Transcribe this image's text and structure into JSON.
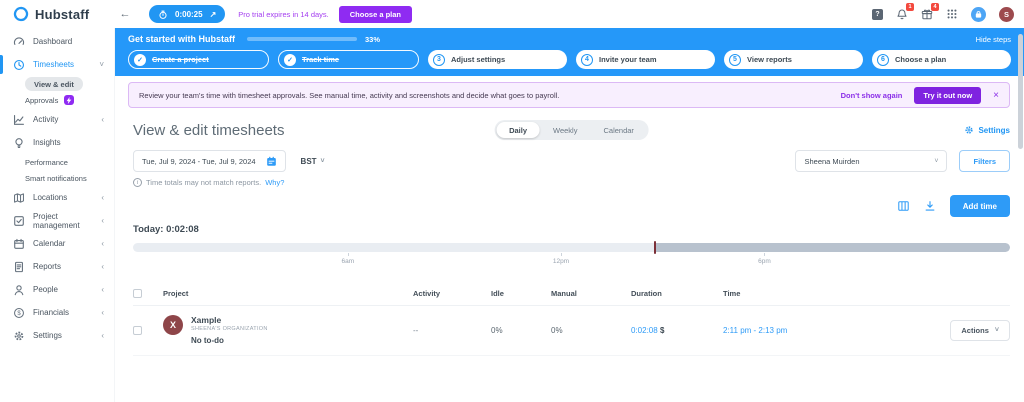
{
  "colors": {
    "accent_blue": "#2196f3",
    "banner_blue": "#2598f9",
    "purple": "#8f2bf2",
    "promo_bg": "#f8effe",
    "badge_red": "#f3493e",
    "avatar_maroon": "#8e4549",
    "timeline_light": "#e9edf2",
    "timeline_dark": "#b8c2ce",
    "timeline_marker": "#7c3038"
  },
  "icons": {
    "chevron_left": "‹",
    "chevron_down": "˅",
    "back_arrow": "←",
    "arrow_up_right": "↗",
    "check": "✓",
    "help": "?",
    "info": "i"
  },
  "topbar": {
    "brand": "Hubstaff",
    "timer_value": "0:00:25",
    "trial_notice": "Pro trial expires in 14 days.",
    "choose_plan_label": "Choose a plan",
    "notifications_badge": "1",
    "gifts_badge": "4",
    "user_initial": "S"
  },
  "onboarding": {
    "title": "Get started with Hubstaff",
    "progress_pct": 33,
    "progress_label": "33%",
    "hide_steps_label": "Hide steps",
    "steps": [
      {
        "label": "Create a project",
        "done": true
      },
      {
        "label": "Track time",
        "done": true
      },
      {
        "num": "3",
        "label": "Adjust settings",
        "done": false
      },
      {
        "num": "4",
        "label": "Invite your team",
        "done": false
      },
      {
        "num": "5",
        "label": "View reports",
        "done": false
      },
      {
        "num": "6",
        "label": "Choose a plan",
        "done": false
      }
    ]
  },
  "promo": {
    "message": "Review your team's time with timesheet approvals. See manual time, activity and screenshots and decide what goes to payroll.",
    "dismiss_label": "Don't show again",
    "cta_label": "Try it out now",
    "close": "×"
  },
  "sidebar": {
    "items": [
      {
        "label": "Dashboard"
      },
      {
        "label": "Timesheets"
      },
      {
        "label": "View & edit"
      },
      {
        "label": "Approvals"
      },
      {
        "label": "Activity"
      },
      {
        "label": "Insights"
      },
      {
        "label": "Performance"
      },
      {
        "label": "Smart notifications"
      },
      {
        "label": "Locations"
      },
      {
        "label": "Project management"
      },
      {
        "label": "Calendar"
      },
      {
        "label": "Reports"
      },
      {
        "label": "People"
      },
      {
        "label": "Financials"
      },
      {
        "label": "Settings"
      }
    ]
  },
  "main": {
    "title": "View & edit timesheets",
    "tabs": [
      "Daily",
      "Weekly",
      "Calendar"
    ],
    "settings_label": "Settings",
    "date_range": "Tue, Jul 9, 2024 - Tue, Jul 9, 2024",
    "timezone": "BST",
    "member": "Sheena Muirden",
    "filters_label": "Filters",
    "info_note": "Time totals may not match reports.",
    "info_link": "Why?",
    "add_time_label": "Add time",
    "today_total": "Today: 0:02:08",
    "timeline": {
      "labels": [
        "6am",
        "12pm",
        "6pm"
      ],
      "split_pct": 59.4
    },
    "table": {
      "headers": [
        "Project",
        "Activity",
        "Idle",
        "Manual",
        "Duration",
        "Time"
      ],
      "rows": [
        {
          "avatar_letter": "X",
          "project": "Xample",
          "org": "SHEENA'S ORGANIZATION",
          "todo": "No to-do",
          "activity": "--",
          "idle": "0%",
          "manual": "0%",
          "duration": "0:02:08",
          "rate": "$",
          "time": "2:11 pm - 2:13 pm",
          "actions_label": "Actions"
        }
      ]
    }
  }
}
